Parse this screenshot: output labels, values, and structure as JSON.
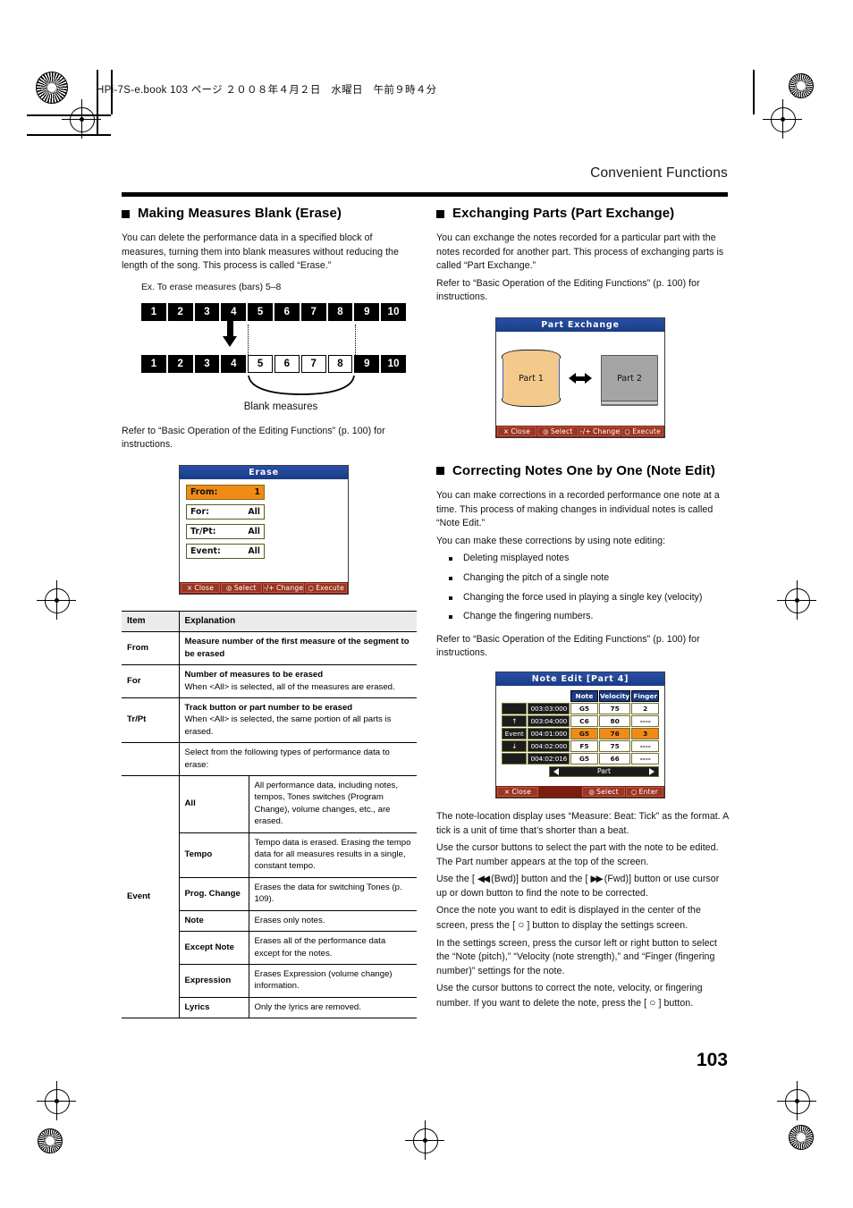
{
  "print_header": {
    "book_line": "HPi-7S-e.book  103 ページ  ２００８年４月２日　水曜日　午前９時４分"
  },
  "running_head": "Convenient Functions",
  "page_number": "103",
  "left_column": {
    "heading": "Making Measures Blank (Erase)",
    "intro": "You can delete the performance data in a specified block of measures, turning them into blank measures without reducing the length of the song. This process is called “Erase.”",
    "example_label": "Ex. To erase measures (bars) 5–8",
    "diagram": {
      "row_before": [
        "1",
        "2",
        "3",
        "4",
        "5",
        "6",
        "7",
        "8",
        "9",
        "10"
      ],
      "row_after": [
        "1",
        "2",
        "3",
        "4",
        "5",
        "6",
        "7",
        "8",
        "9",
        "10"
      ],
      "blank_indices": [
        4,
        5,
        6,
        7
      ],
      "caption": "Blank measures"
    },
    "refer": "Refer to “Basic Operation of the Editing Functions” (p. 100) for instructions.",
    "lcd": {
      "title": "Erase",
      "fields": [
        {
          "label": "From:",
          "value": "1",
          "selected": true
        },
        {
          "label": "For:",
          "value": "All",
          "selected": false
        },
        {
          "label": "Tr/Pt:",
          "value": "All",
          "selected": false
        },
        {
          "label": "Event:",
          "value": "All",
          "selected": false
        }
      ],
      "footer": [
        {
          "icon": "×",
          "label": "Close"
        },
        {
          "icon": "◎",
          "label": "Select"
        },
        {
          "icon": "-/+",
          "label": "Change"
        },
        {
          "icon": "○",
          "label": "Execute"
        }
      ]
    },
    "table": {
      "headers": [
        "Item",
        "Explanation"
      ],
      "rows": [
        {
          "item": "From",
          "lines": [
            {
              "text": "Measure number of the first measure of the segment to be erased",
              "bold": true
            }
          ]
        },
        {
          "item": "For",
          "lines": [
            {
              "text": "Number of measures to be erased",
              "bold": true
            },
            {
              "text": "When <All> is selected, all of the measures are erased.",
              "bold": false
            }
          ]
        },
        {
          "item": "Tr/Pt",
          "lines": [
            {
              "text": "Track button or part number to be erased",
              "bold": true
            },
            {
              "text": "When <All> is selected, the same portion of all parts is erased.",
              "bold": false
            }
          ]
        }
      ],
      "event_intro": "Select from the following types of performance data to erase:",
      "event_item": "Event",
      "event_rows": [
        {
          "name": "All",
          "text": "All performance data, including notes, tempos, Tones switches (Program Change), volume changes, etc., are erased."
        },
        {
          "name": "Tempo",
          "text": "Tempo data is erased. Erasing the tempo data for all measures results in a single, constant tempo."
        },
        {
          "name": "Prog. Change",
          "text": "Erases the data for switching Tones (p. 109)."
        },
        {
          "name": "Note",
          "text": "Erases only notes."
        },
        {
          "name": "Except Note",
          "text": "Erases all of the performance data except for the notes."
        },
        {
          "name": "Expression",
          "text": "Erases Expression (volume change) information."
        },
        {
          "name": "Lyrics",
          "text": "Only the lyrics are removed."
        }
      ]
    }
  },
  "right_column": {
    "part_exchange": {
      "heading": "Exchanging Parts (Part Exchange)",
      "intro": "You can exchange the notes recorded for a particular part with the notes recorded for another part. This process of exchanging parts is called “Part Exchange.”",
      "refer": "Refer to “Basic Operation of the Editing Functions” (p. 100) for instructions.",
      "lcd": {
        "title": "Part Exchange",
        "part_a": "Part 1",
        "part_b": "Part 2",
        "footer": [
          {
            "icon": "×",
            "label": "Close"
          },
          {
            "icon": "◎",
            "label": "Select"
          },
          {
            "icon": "-/+",
            "label": "Change"
          },
          {
            "icon": "○",
            "label": "Execute"
          }
        ]
      }
    },
    "note_edit": {
      "heading": "Correcting Notes One by One (Note Edit)",
      "intro1": "You can make corrections in a recorded performance one note at a time. This process of making changes in individual notes is called “Note Edit.”",
      "intro2": "You can make these corrections by using note editing:",
      "bullets": [
        "Deleting misplayed notes",
        "Changing the pitch of a single note",
        "Changing the force used in playing a single key (velocity)",
        "Change the fingering numbers."
      ],
      "refer": "Refer to “Basic Operation of the Editing Functions” (p. 100) for instructions.",
      "lcd": {
        "title": "Note Edit [Part 4]",
        "columns": [
          "Note",
          "Velocity",
          "Finger"
        ],
        "rows": [
          {
            "tag": "",
            "time": "003:03:000",
            "note": "G5",
            "velocity": "75",
            "finger": "2",
            "selected": false
          },
          {
            "tag": "↑",
            "time": "003:04:000",
            "note": "C6",
            "velocity": "80",
            "finger": "----",
            "selected": false
          },
          {
            "tag": "Event",
            "time": "004:01:000",
            "note": "G5",
            "velocity": "76",
            "finger": "3",
            "selected": true
          },
          {
            "tag": "↓",
            "time": "004:02:000",
            "note": "F5",
            "velocity": "75",
            "finger": "----",
            "selected": false
          },
          {
            "tag": "",
            "time": "004:02:016",
            "note": "G5",
            "velocity": "66",
            "finger": "----",
            "selected": false
          }
        ],
        "part_nav": "Part",
        "footer": [
          {
            "icon": "×",
            "label": "Close"
          },
          {
            "icon": "◎",
            "label": "Select"
          },
          {
            "icon": "○",
            "label": "Enter"
          }
        ]
      },
      "para1": "The note-location display uses “Measure: Beat: Tick” as the format. A tick is a unit of time that’s shorter than a beat.",
      "para2": "Use the cursor buttons to select the part with the note to be edited. The Part number appears at the top of the screen.",
      "para3_a": "Use the [ ",
      "para3_b": " (Bwd)] button and the [ ",
      "para3_c": " (Fwd)] button or use cursor up or down button to find the note to be corrected.",
      "para4_a": "Once the note you want to edit is displayed in the center of the screen, press the [ ",
      "para4_b": " ] button to display the settings screen.",
      "para5": "In the settings screen, press the cursor left or right button to select the “Note (pitch),” “Velocity (note strength),” and “Finger (fingering number)” settings for the note.",
      "para6_a": "Use the cursor buttons to correct the note, velocity, or fingering number. If you want to delete the note, press the [ ",
      "para6_b": " ] button."
    }
  }
}
